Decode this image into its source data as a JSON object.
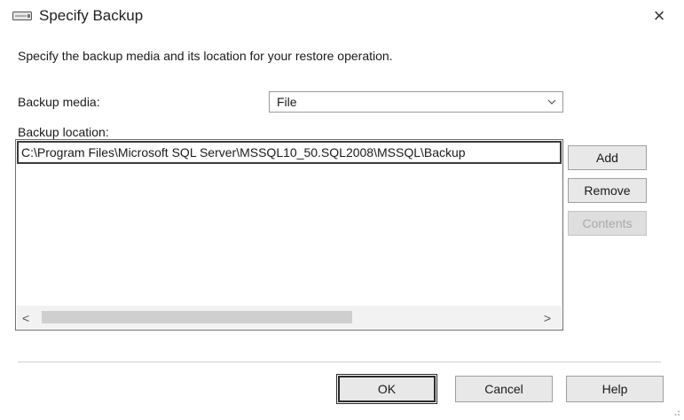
{
  "window": {
    "title": "Specify Backup",
    "close_glyph": "×",
    "title_icon": "backup-device-icon"
  },
  "instruction": "Specify the backup media and its location for your restore operation.",
  "backup_media": {
    "label": "Backup media:",
    "selected": "File"
  },
  "backup_location": {
    "label": "Backup location:",
    "items": [
      "C:\\Program Files\\Microsoft SQL Server\\MSSQL10_50.SQL2008\\MSSQL\\Backup"
    ],
    "scroll_left": "<",
    "scroll_right": ">"
  },
  "side_buttons": {
    "add": "Add",
    "remove": "Remove",
    "contents": "Contents"
  },
  "footer_buttons": {
    "ok": "OK",
    "cancel": "Cancel",
    "help": "Help"
  }
}
